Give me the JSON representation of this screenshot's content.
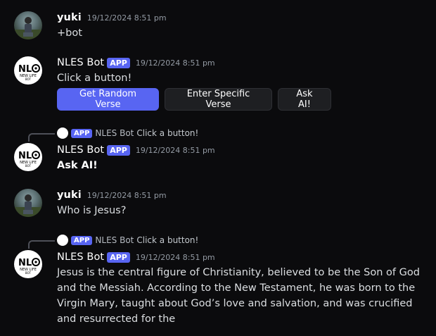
{
  "messages": [
    {
      "author": "yuki",
      "timestamp": "19/12/2024 8:51 pm",
      "text": "+bot"
    },
    {
      "author": "NLES Bot",
      "tag": "APP",
      "timestamp": "19/12/2024 8:51 pm",
      "text": "Click a button!",
      "buttons": [
        "Get Random Verse",
        "Enter Specific Verse",
        "Ask AI!"
      ]
    },
    {
      "reply": {
        "tag": "APP",
        "author": "NLES Bot",
        "text": "Click a button!"
      },
      "author": "NLES Bot",
      "tag": "APP",
      "timestamp": "19/12/2024 8:51 pm",
      "text": "Ask AI!"
    },
    {
      "author": "yuki",
      "timestamp": "19/12/2024 8:51 pm",
      "text": "Who is Jesus?"
    },
    {
      "reply": {
        "tag": "APP",
        "author": "NLES Bot",
        "text": "Click a button!"
      },
      "author": "NLES Bot",
      "tag": "APP",
      "timestamp": "19/12/2024 8:51 pm",
      "text": "Jesus is the central figure of Christianity, believed to be the Son of God and the Messiah. According to the New Testament, he was born to the Virgin Mary, taught about God’s love and salvation, and was crucified and resurrected for the"
    }
  ],
  "logo": {
    "line1": "NL",
    "line2": "NEW LIFE",
    "line3": "BOT"
  },
  "colors": {
    "background": "#0b0b0d",
    "app_tag": "#5865f2",
    "primary_button": "#5865f2",
    "secondary_button": "#1e1f22"
  }
}
